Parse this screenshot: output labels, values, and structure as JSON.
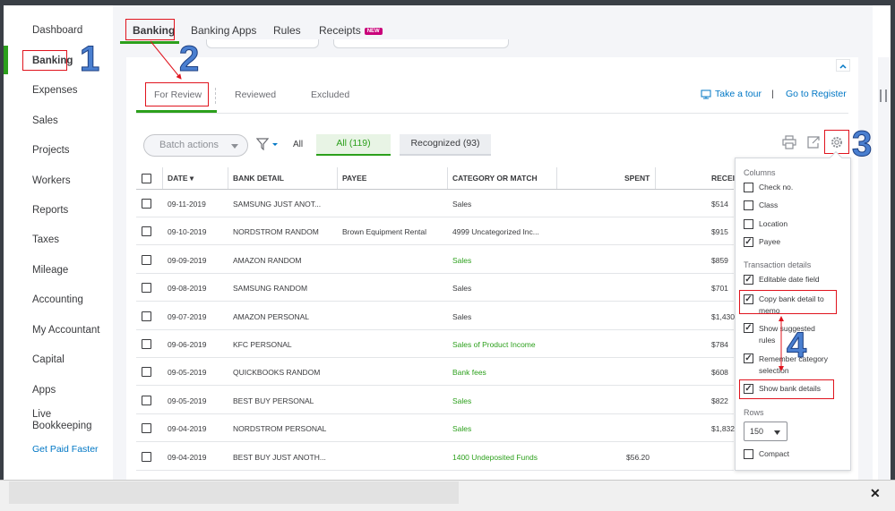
{
  "sidebar": {
    "items": [
      {
        "label": "Dashboard"
      },
      {
        "label": "Banking"
      },
      {
        "label": "Expenses"
      },
      {
        "label": "Sales"
      },
      {
        "label": "Projects"
      },
      {
        "label": "Workers"
      },
      {
        "label": "Reports"
      },
      {
        "label": "Taxes"
      },
      {
        "label": "Mileage"
      },
      {
        "label": "Accounting"
      },
      {
        "label": "My Accountant"
      },
      {
        "label": "Capital"
      },
      {
        "label": "Apps"
      },
      {
        "label_line1": "Live",
        "label_line2": "Bookkeeping"
      }
    ],
    "promo_link": "Get Paid Faster"
  },
  "top_tabs": [
    "Banking",
    "Banking Apps",
    "Rules",
    "Receipts"
  ],
  "new_badge": "NEW",
  "sub_tabs": [
    "For Review",
    "Reviewed",
    "Excluded"
  ],
  "links": {
    "take_tour": "Take a tour",
    "separator": "|",
    "go_register": "Go to Register"
  },
  "toolbar": {
    "batch_actions": "Batch actions",
    "all_text": "All",
    "all_pill": "All (119)",
    "recognized_pill": "Recognized (93)"
  },
  "table": {
    "headers": [
      "DATE",
      "BANK DETAIL",
      "PAYEE",
      "CATEGORY OR MATCH",
      "SPENT",
      "RECEI"
    ],
    "rows": [
      {
        "date": "09-11-2019",
        "bank": "SAMSUNG JUST ANOT...",
        "payee": "",
        "category": "Sales",
        "green": false,
        "spent": "",
        "received": "$514"
      },
      {
        "date": "09-10-2019",
        "bank": "NORDSTROM RANDOM",
        "payee": "Brown Equipment Rental",
        "category": "4999 Uncategorized Inc...",
        "green": false,
        "spent": "",
        "received": "$915"
      },
      {
        "date": "09-09-2019",
        "bank": "AMAZON RANDOM",
        "payee": "",
        "category": "Sales",
        "green": true,
        "spent": "",
        "received": "$859"
      },
      {
        "date": "09-08-2019",
        "bank": "SAMSUNG RANDOM",
        "payee": "",
        "category": "Sales",
        "green": false,
        "spent": "",
        "received": "$701"
      },
      {
        "date": "09-07-2019",
        "bank": "AMAZON PERSONAL",
        "payee": "",
        "category": "Sales",
        "green": false,
        "spent": "",
        "received": "$1,430"
      },
      {
        "date": "09-06-2019",
        "bank": "KFC PERSONAL",
        "payee": "",
        "category": "Sales of Product Income",
        "green": true,
        "spent": "",
        "received": "$784"
      },
      {
        "date": "09-05-2019",
        "bank": "QUICKBOOKS RANDOM",
        "payee": "",
        "category": "Bank fees",
        "green": true,
        "spent": "",
        "received": "$608"
      },
      {
        "date": "09-05-2019",
        "bank": "BEST BUY PERSONAL",
        "payee": "",
        "category": "Sales",
        "green": true,
        "spent": "",
        "received": "$822"
      },
      {
        "date": "09-04-2019",
        "bank": "NORDSTROM PERSONAL",
        "payee": "",
        "category": "Sales",
        "green": true,
        "spent": "",
        "received": "$1,832"
      },
      {
        "date": "09-04-2019",
        "bank": "BEST BUY JUST ANOTH...",
        "payee": "",
        "category": "1400 Undeposited Funds",
        "green": true,
        "spent": "$56.20",
        "received": ""
      }
    ]
  },
  "settings_panel": {
    "columns_heading": "Columns",
    "columns": [
      {
        "label": "Check no.",
        "checked": false
      },
      {
        "label": "Class",
        "checked": false
      },
      {
        "label": "Location",
        "checked": false
      },
      {
        "label": "Payee",
        "checked": true
      }
    ],
    "transaction_heading": "Transaction details",
    "transaction": [
      {
        "label": "Editable date field",
        "checked": true
      },
      {
        "label_line1": "Copy bank detail to",
        "label_line2": "memo",
        "checked": true
      },
      {
        "label_line1": "Show suggested",
        "label_line2": "rules",
        "checked": true
      },
      {
        "label_line1": "Remember category",
        "label_line2": "selection",
        "checked": true
      },
      {
        "label": "Show bank details",
        "checked": true
      }
    ],
    "rows_heading": "Rows",
    "rows_value": "150",
    "compact": {
      "label": "Compact",
      "checked": false
    }
  },
  "annotations": [
    "1",
    "2",
    "3",
    "4"
  ],
  "colors": {
    "accent_green": "#2ca01c",
    "link_blue": "#0077c5",
    "annotation_red": "#e0141e",
    "annotation_blue": "#4a7fd0"
  },
  "icons": [
    "filter-icon",
    "print-icon",
    "export-icon",
    "gear-icon",
    "chevron-up-icon",
    "close-icon"
  ],
  "close_glyph": "✕",
  "check_glyph": "✓",
  "sort_glyph": "▾"
}
